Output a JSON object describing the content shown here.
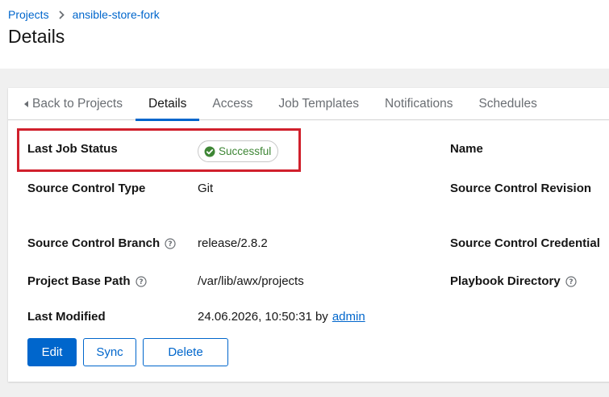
{
  "breadcrumb": {
    "parent": "Projects",
    "current": "ansible-store-fork"
  },
  "page": {
    "title": "Details"
  },
  "tabs": [
    "Back to Projects",
    "Details",
    "Access",
    "Job Templates",
    "Notifications",
    "Schedules"
  ],
  "active_tab": "Details",
  "details": {
    "last_job_status": {
      "label": "Last Job Status",
      "value": "Successful",
      "status_color": "#3e8635"
    },
    "name": {
      "label": "Name"
    },
    "source_control_type": {
      "label": "Source Control Type",
      "value": "Git"
    },
    "source_control_revision": {
      "label": "Source Control Revision"
    },
    "source_control_branch": {
      "label": "Source Control Branch",
      "value": "release/2.8.2"
    },
    "source_control_credential": {
      "label": "Source Control Credential"
    },
    "project_base_path": {
      "label": "Project Base Path",
      "value": "/var/lib/awx/projects"
    },
    "playbook_directory": {
      "label": "Playbook Directory"
    },
    "last_modified": {
      "label": "Last Modified",
      "value": "24.06.2026, 10:50:31 by",
      "user": "admin"
    }
  },
  "buttons": {
    "edit": "Edit",
    "sync": "Sync",
    "delete": "Delete"
  },
  "colors": {
    "accent": "#0066cc",
    "success": "#3e8635",
    "highlight": "#d0202c"
  }
}
